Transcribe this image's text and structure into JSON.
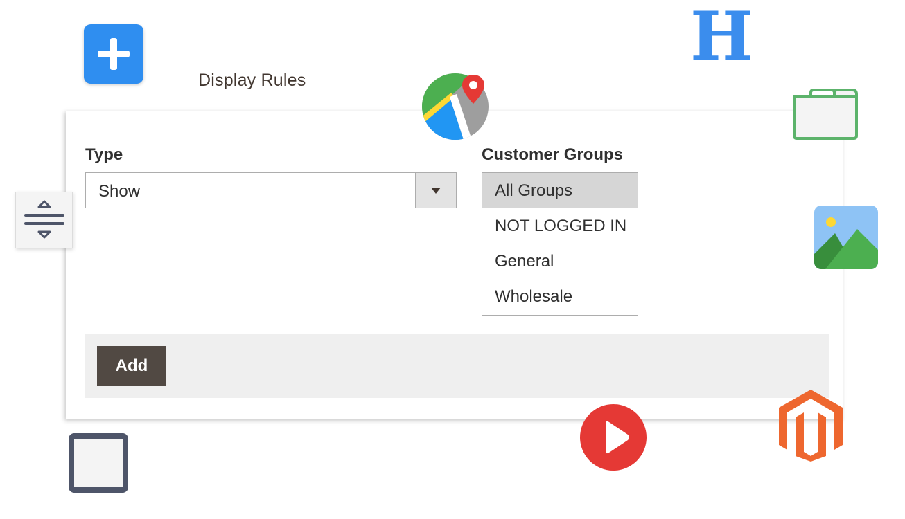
{
  "tab": {
    "title": "Display Rules"
  },
  "form": {
    "type_label": "Type",
    "type_value": "Show",
    "groups_label": "Customer Groups",
    "groups": [
      {
        "label": "All Groups",
        "selected": true
      },
      {
        "label": "NOT LOGGED IN",
        "selected": false
      },
      {
        "label": "General",
        "selected": false
      },
      {
        "label": "Wholesale",
        "selected": false
      }
    ],
    "add_label": "Add"
  },
  "icons": {
    "plus": "plus-icon",
    "divider": "divider-icon",
    "square": "square-icon",
    "map": "map-pin-icon",
    "heading": "heading-icon",
    "tabs": "tabs-icon",
    "image": "image-icon",
    "video": "video-play-icon",
    "brand": "magento-logo-icon",
    "heading_glyph": "H"
  },
  "colors": {
    "brand_button": "#514943",
    "plus_blue": "#2f8ef0",
    "heading_blue": "#3b8ded",
    "tabs_green": "#5cb36b",
    "video_red": "#e53935",
    "magento_orange": "#ee672f",
    "square_slate": "#4e5569"
  }
}
